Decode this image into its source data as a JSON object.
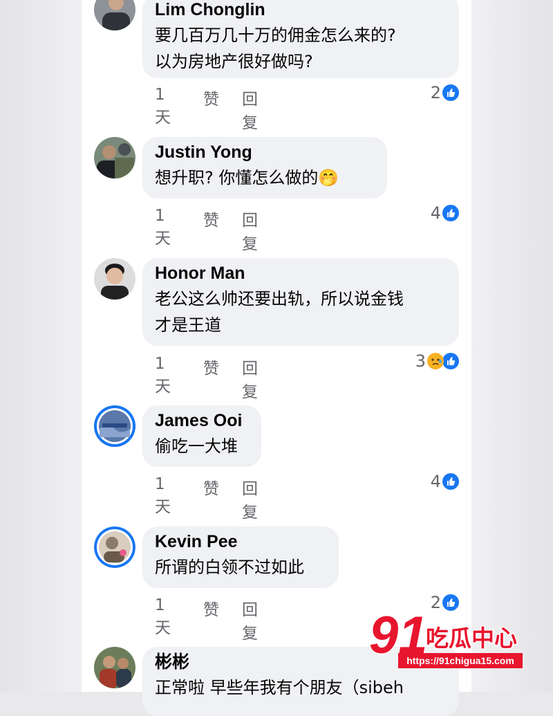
{
  "comments": [
    {
      "name": "Lim Chonglin",
      "text": "要几百万几十万的佣金怎么来的?\n以为房地产很好做吗?",
      "time": "1天",
      "like": "赞",
      "reply": "回复",
      "count": "2",
      "reactions": [
        "like-icon"
      ]
    },
    {
      "name": "Justin Yong",
      "text": "想升职? 你懂怎么做的🤭",
      "time": "1天",
      "like": "赞",
      "reply": "回复",
      "count": "4",
      "reactions": [
        "like-icon"
      ]
    },
    {
      "name": "Honor Man",
      "text": "老公这么帅还要出轨，所以说金钱\n才是王道",
      "time": "1天",
      "like": "赞",
      "reply": "回复",
      "count": "3",
      "reactions": [
        "sad-icon",
        "like-icon"
      ]
    },
    {
      "name": "James Ooi",
      "text": "偷吃一大堆",
      "time": "1天",
      "like": "赞",
      "reply": "回复",
      "count": "4",
      "reactions": [
        "like-icon"
      ]
    },
    {
      "name": "Kevin Pee",
      "text": "所谓的白领不过如此",
      "time": "1天",
      "like": "赞",
      "reply": "回复",
      "count": "2",
      "reactions": [
        "like-icon"
      ]
    },
    {
      "name": "彬彬",
      "text": "正常啦 早些年我有个朋友（sibeh",
      "time": "",
      "like": "",
      "reply": "",
      "count": "",
      "reactions": []
    }
  ],
  "watermark": {
    "brand_number": "91",
    "brand_text": "吃瓜中心",
    "url": "https://91chigua15.com"
  },
  "colors": {
    "like_blue": "#1877f2",
    "bubble_gray": "#f0f1f4",
    "meta_gray": "#65676b",
    "watermark_red": "#e8152e"
  }
}
